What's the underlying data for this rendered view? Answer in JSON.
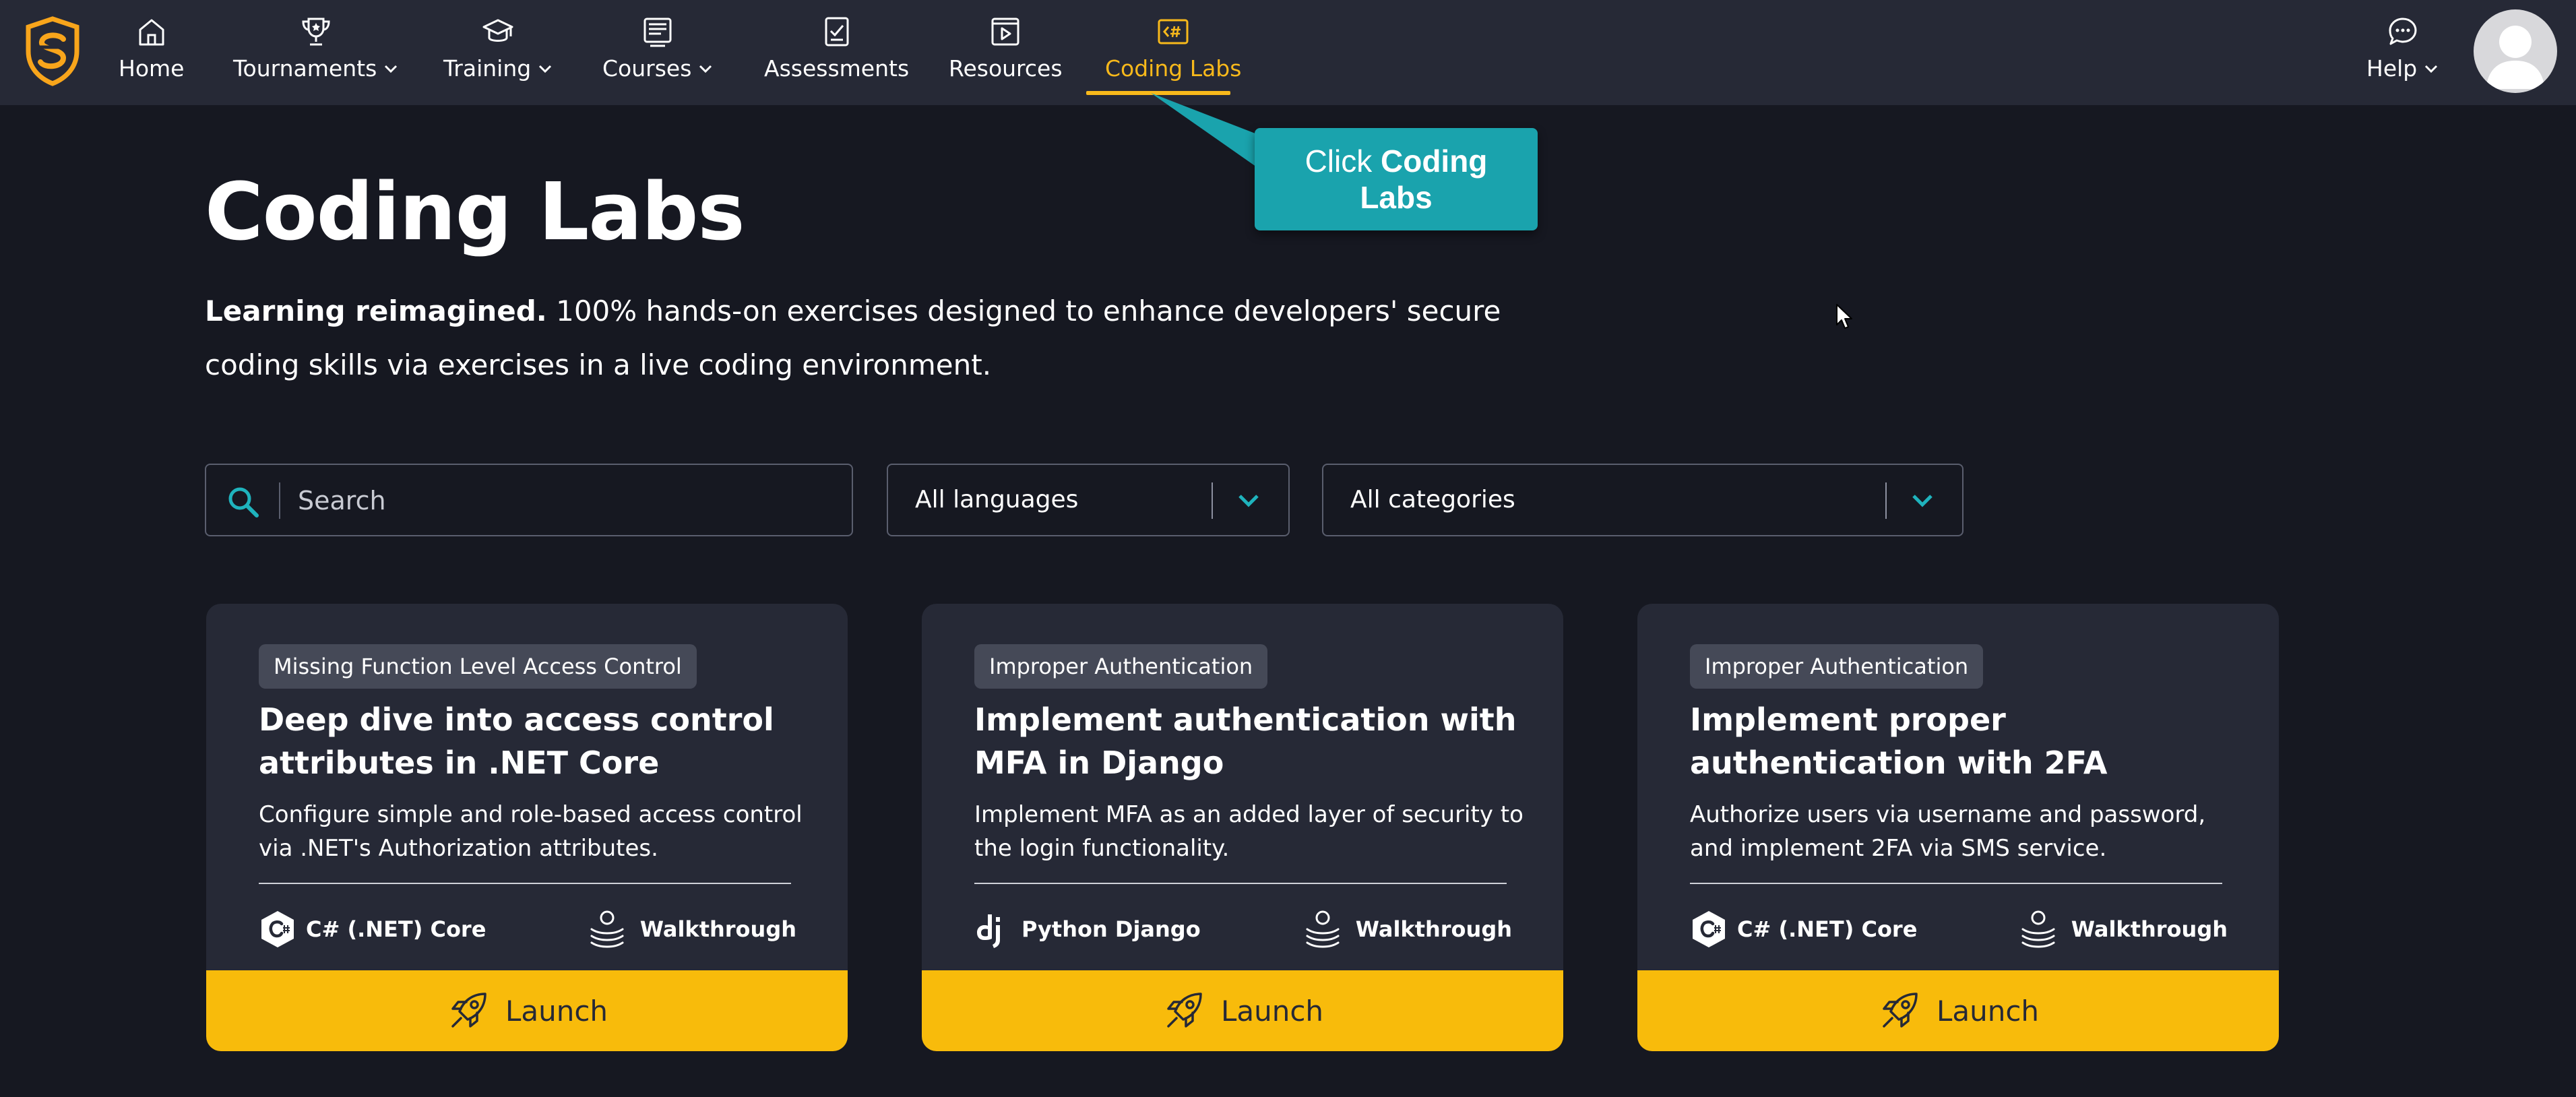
{
  "nav": {
    "items": [
      {
        "label": "Home",
        "icon": "home-icon"
      },
      {
        "label": "Tournaments",
        "icon": "trophy-icon"
      },
      {
        "label": "Training",
        "icon": "graduation-cap-icon"
      },
      {
        "label": "Courses",
        "icon": "courses-icon"
      },
      {
        "label": "Assessments",
        "icon": "assessment-checklist-icon"
      },
      {
        "label": "Resources",
        "icon": "video-resource-icon"
      },
      {
        "label": "Coding Labs",
        "icon": "code-lab-icon"
      },
      {
        "label": "Help",
        "icon": "chat-bubble-icon"
      }
    ],
    "active": "Coding Labs",
    "accent_color": "#f8b91b"
  },
  "callout": {
    "prefix": "Click",
    "bold": "Coding Labs",
    "color": "#1aa3ad"
  },
  "hero": {
    "title": "Coding Labs",
    "desc_bold": "Learning reimagined.",
    "desc_rest": " 100% hands-on exercises designed to enhance developers' secure coding skills via exercises in a live coding environment."
  },
  "filters": {
    "search_placeholder": "Search",
    "language": "All languages",
    "category": "All categories"
  },
  "cards": [
    {
      "tag": "Missing Function Level Access Control",
      "title": "Deep dive into access control attributes in .NET Core",
      "desc": "Configure simple and role-based access control via .NET's Authorization attributes.",
      "language": "C# (.NET) Core",
      "language_icon": "csharp-icon",
      "mode": "Walkthrough",
      "launch": "Launch"
    },
    {
      "tag": "Improper Authentication",
      "title": "Implement authentication with MFA in Django",
      "desc": "Implement MFA as an added layer of security to the login functionality.",
      "language": "Python Django",
      "language_icon": "django-icon",
      "mode": "Walkthrough",
      "launch": "Launch"
    },
    {
      "tag": "Improper Authentication",
      "title": "Implement proper authentication with 2FA",
      "desc": "Authorize users via username and password, and implement 2FA via SMS service.",
      "language": "C# (.NET) Core",
      "language_icon": "csharp-icon",
      "mode": "Walkthrough",
      "launch": "Launch"
    }
  ],
  "colors": {
    "background": "#161821",
    "surface": "#262936",
    "launch": "#f8bb0b",
    "accent": "#f8b91b",
    "teal": "#1aa3ad"
  }
}
